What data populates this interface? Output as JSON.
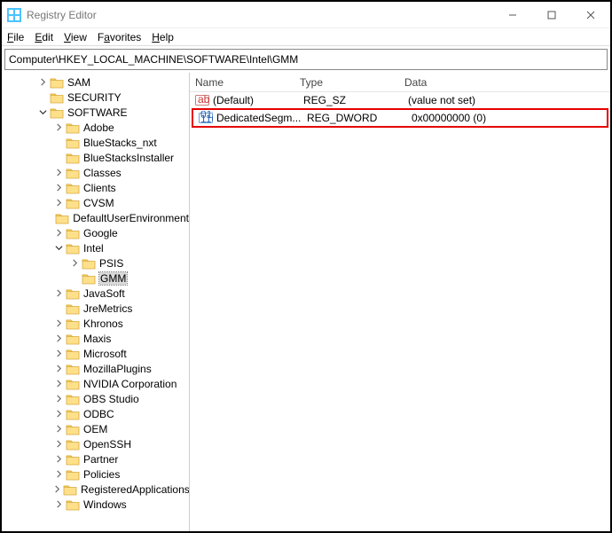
{
  "window": {
    "title": "Registry Editor"
  },
  "menus": {
    "file": "File",
    "edit": "Edit",
    "view": "View",
    "favorites": "Favorites",
    "help": "Help"
  },
  "address": "Computer\\HKEY_LOCAL_MACHINE\\SOFTWARE\\Intel\\GMM",
  "tree": {
    "sam": "SAM",
    "security": "SECURITY",
    "software": "SOFTWARE",
    "items": [
      "Adobe",
      "BlueStacks_nxt",
      "BlueStacksInstaller",
      "Classes",
      "Clients",
      "CVSM",
      "DefaultUserEnvironment",
      "Google",
      "Intel",
      "PSIS",
      "GMM",
      "JavaSoft",
      "JreMetrics",
      "Khronos",
      "Maxis",
      "Microsoft",
      "MozillaPlugins",
      "NVIDIA Corporation",
      "OBS Studio",
      "ODBC",
      "OEM",
      "OpenSSH",
      "Partner",
      "Policies",
      "RegisteredApplications",
      "Windows"
    ]
  },
  "list": {
    "headers": {
      "name": "Name",
      "type": "Type",
      "data": "Data"
    },
    "rows": [
      {
        "name": "(Default)",
        "type": "REG_SZ",
        "data": "(value not set)"
      },
      {
        "name": "DedicatedSegm...",
        "type": "REG_DWORD",
        "data": "0x00000000 (0)"
      }
    ]
  }
}
